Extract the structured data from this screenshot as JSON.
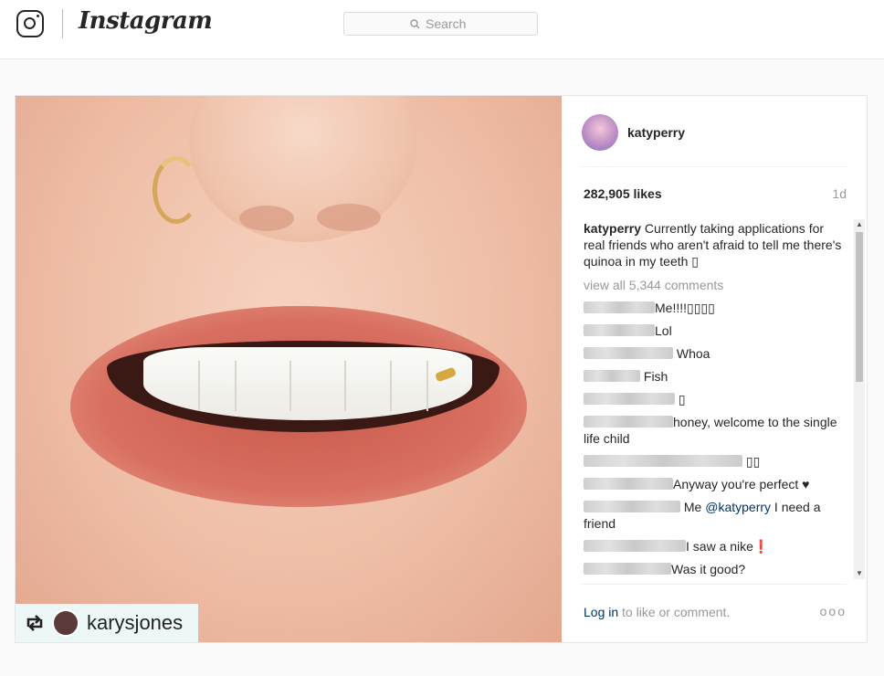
{
  "header": {
    "wordmark": "Instagram",
    "search_placeholder": "Search"
  },
  "post": {
    "repost_user": "karysjones",
    "author": "katyperry",
    "likes": "282,905 likes",
    "age": "1d",
    "caption_user": "katyperry",
    "caption_text": " Currently taking applications for real friends who aren't afraid to tell me there's quinoa in my teeth ▯",
    "view_all": "view all 5,344 comments",
    "comments": [
      {
        "text": "Me!!!!▯▯▯▯"
      },
      {
        "text": "Lol"
      },
      {
        "text": " Whoa"
      },
      {
        "text": " Fish"
      },
      {
        "text": " ▯"
      },
      {
        "text": "honey, welcome to the single life child"
      },
      {
        "text": " ▯▯"
      },
      {
        "text": "Anyway you're perfect ♥"
      },
      {
        "text_before": " Me ",
        "mention": "@katyperry",
        "text_after": " I need a friend"
      },
      {
        "text": "I saw a nike❗"
      },
      {
        "text": "Was it good?"
      }
    ],
    "login_link": "Log in",
    "login_text": " to like or comment.",
    "more": "ooo"
  }
}
